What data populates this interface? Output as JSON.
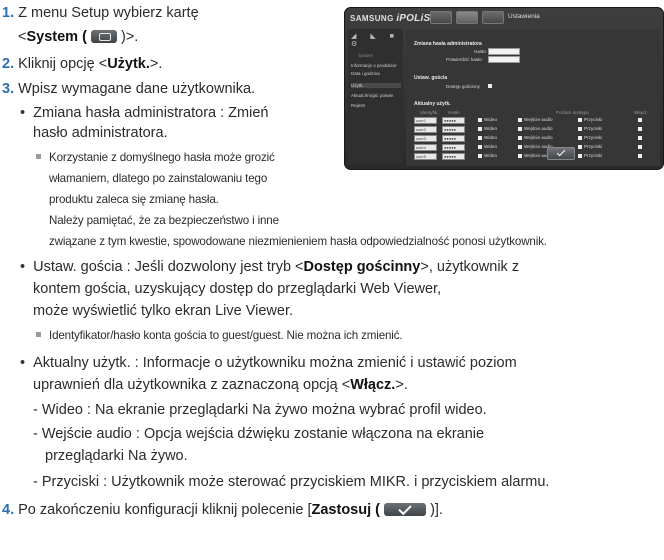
{
  "steps": {
    "s1_num": "1.",
    "s1_text": "Z menu Setup wybierz kartę",
    "s1_line2_pre": "<",
    "s1_system": "System (",
    "s1_line2_post": ")>.",
    "s2_num": "2.",
    "s2_pre": "Kliknij opcję <",
    "s2_bold": "Użytk.",
    "s2_post": ">.",
    "s3_num": "3.",
    "s3_text": "Wpisz wymagane dane użytkownika.",
    "s4_num": "4.",
    "s4_pre": "Po zakończeniu konfiguracji kliknij polecenie [",
    "s4_bold": "Zastosuj (",
    "s4_post": ")]."
  },
  "bullets": {
    "b1_l1": "Zmiana hasła administratora : Zmień",
    "b1_l2": "hasło administratora.",
    "n1_l1": "Korzystanie z domyślnego hasła może grozić",
    "n1_l2": "włamaniem, dlatego po zainstalowaniu tego",
    "n1_l3": "produktu zaleca się zmianę hasła.",
    "n1_l4": "Należy pamiętać, że za bezpieczeństwo i inne",
    "n1_l5": "związane z tym kwestie, spowodowane niezmienieniem hasła odpowiedzialność ponosi użytkownik.",
    "b2_l1_pre": "Ustaw. gościa : Jeśli dozwolony jest tryb <",
    "b2_l1_bold": "Dostęp gościnny",
    "b2_l1_post": ">, użytkownik z",
    "b2_l2": "kontem gościa, uzyskujący dostęp do przeglądarki Web Viewer,",
    "b2_l3": "może wyświetlić tylko ekran Live Viewer.",
    "n2_l1": "Identyfikator/hasło konta gościa to guest/guest. Nie można ich zmienić.",
    "b3_l1": "Aktualny użytk. : Informacje o użytkowniku można zmienić i ustawić poziom",
    "b3_l2_pre": "uprawnień dla użytkownika z zaznaczoną opcją <",
    "b3_l2_bold": "Włącz.",
    "b3_l2_post": ">.",
    "d1": "- Wideo : Na ekranie przeglądarki Na żywo można wybrać profil wideo.",
    "d2_l1": "- Wejście audio : Opcja wejścia dźwięku zostanie włączona na ekranie",
    "d2_l2": "przeglądarki Na żywo.",
    "d3": "- Przyciski : Użytkownik może sterować przyciskiem MIKR. i przyciskiem alarmu.",
    "bullet_char": "•"
  },
  "screenshot": {
    "brand_pre": "SAMSUNG ",
    "brand_italic": "iPOLiS",
    "title": "Ustawienia",
    "side_header": "System",
    "side_items": [
      "Informacje o produkcie",
      "Data i godzina",
      "Użytk.",
      "Aktual./Inicjal. potwie.",
      "Rejestr"
    ],
    "sec_admin": "Zmiana hasła administratora",
    "lbl_new": "Hasło",
    "lbl_confirm": "Potwierdzić hasło",
    "sec_guest": "Ustaw. gościa",
    "lbl_guest": "Dostęp gościnny",
    "sec_current": "Aktualny użytk.",
    "col_id": "Identyfik.",
    "col_pw": "Hasło",
    "col_profile": "Poziom dostępu",
    "col_enable": "Włącz.",
    "users": [
      "user1",
      "user2",
      "user3",
      "user4",
      "user5"
    ],
    "pw_mask": "●●●●●",
    "opt_video": "Wideo",
    "opt_audio": "Wejście audio",
    "opt_btn": "Przyciski"
  }
}
